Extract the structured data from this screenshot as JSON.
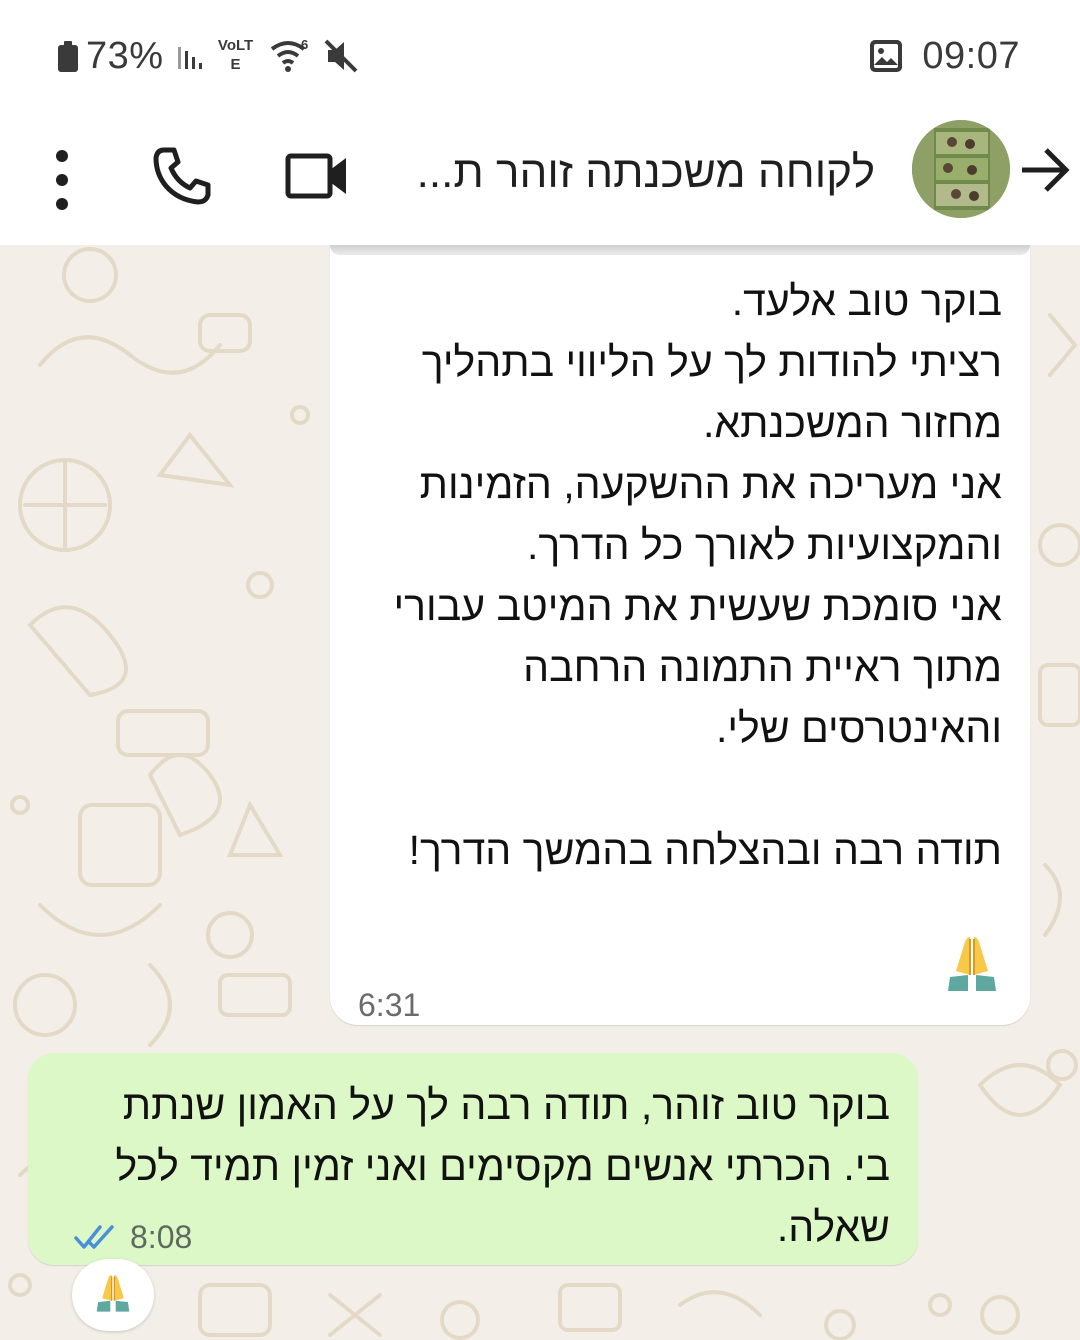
{
  "status_bar": {
    "battery": "73%",
    "network_label": "VoLTE",
    "time": "09:07",
    "icons": [
      "battery-icon",
      "signal-icon",
      "volte-icon",
      "wifi-6-icon",
      "mute-icon",
      "image-notification-icon"
    ]
  },
  "header": {
    "contact_name": "לקוחה משכנתה זוהר ת...",
    "icons": [
      "more-vert-icon",
      "phone-icon",
      "video-icon",
      "back-arrow-icon",
      "avatar"
    ]
  },
  "messages": [
    {
      "direction": "incoming",
      "text": "בוקר טוב אלעד.\nרציתי להודות לך על הליווי בתהליך מחזור המשכנתא.\nאני מעריכה את ההשקעה, הזמינות והמקצועיות לאורך כל הדרך.\nאני סומכת שעשית את המיטב עבורי מתוך ראיית התמונה הרחבה והאינטרסים שלי.\n\nתודה רבה ובהצלחה בהמשך הדרך!",
      "emoji": "🙏",
      "time": "6:31"
    },
    {
      "direction": "outgoing",
      "text": "בוקר טוב זוהר, תודה רבה לך על האמון שנתת בי. הכרתי אנשים מקסימים ואני זמין תמיד לכל שאלה.",
      "time": "8:08",
      "status": "read",
      "reaction": "🙏"
    }
  ],
  "colors": {
    "incoming_bubble": "#ffffff",
    "outgoing_bubble": "#dcf8c6",
    "wallpaper": "#f3efe8",
    "read_ticks": "#4a90d9"
  }
}
